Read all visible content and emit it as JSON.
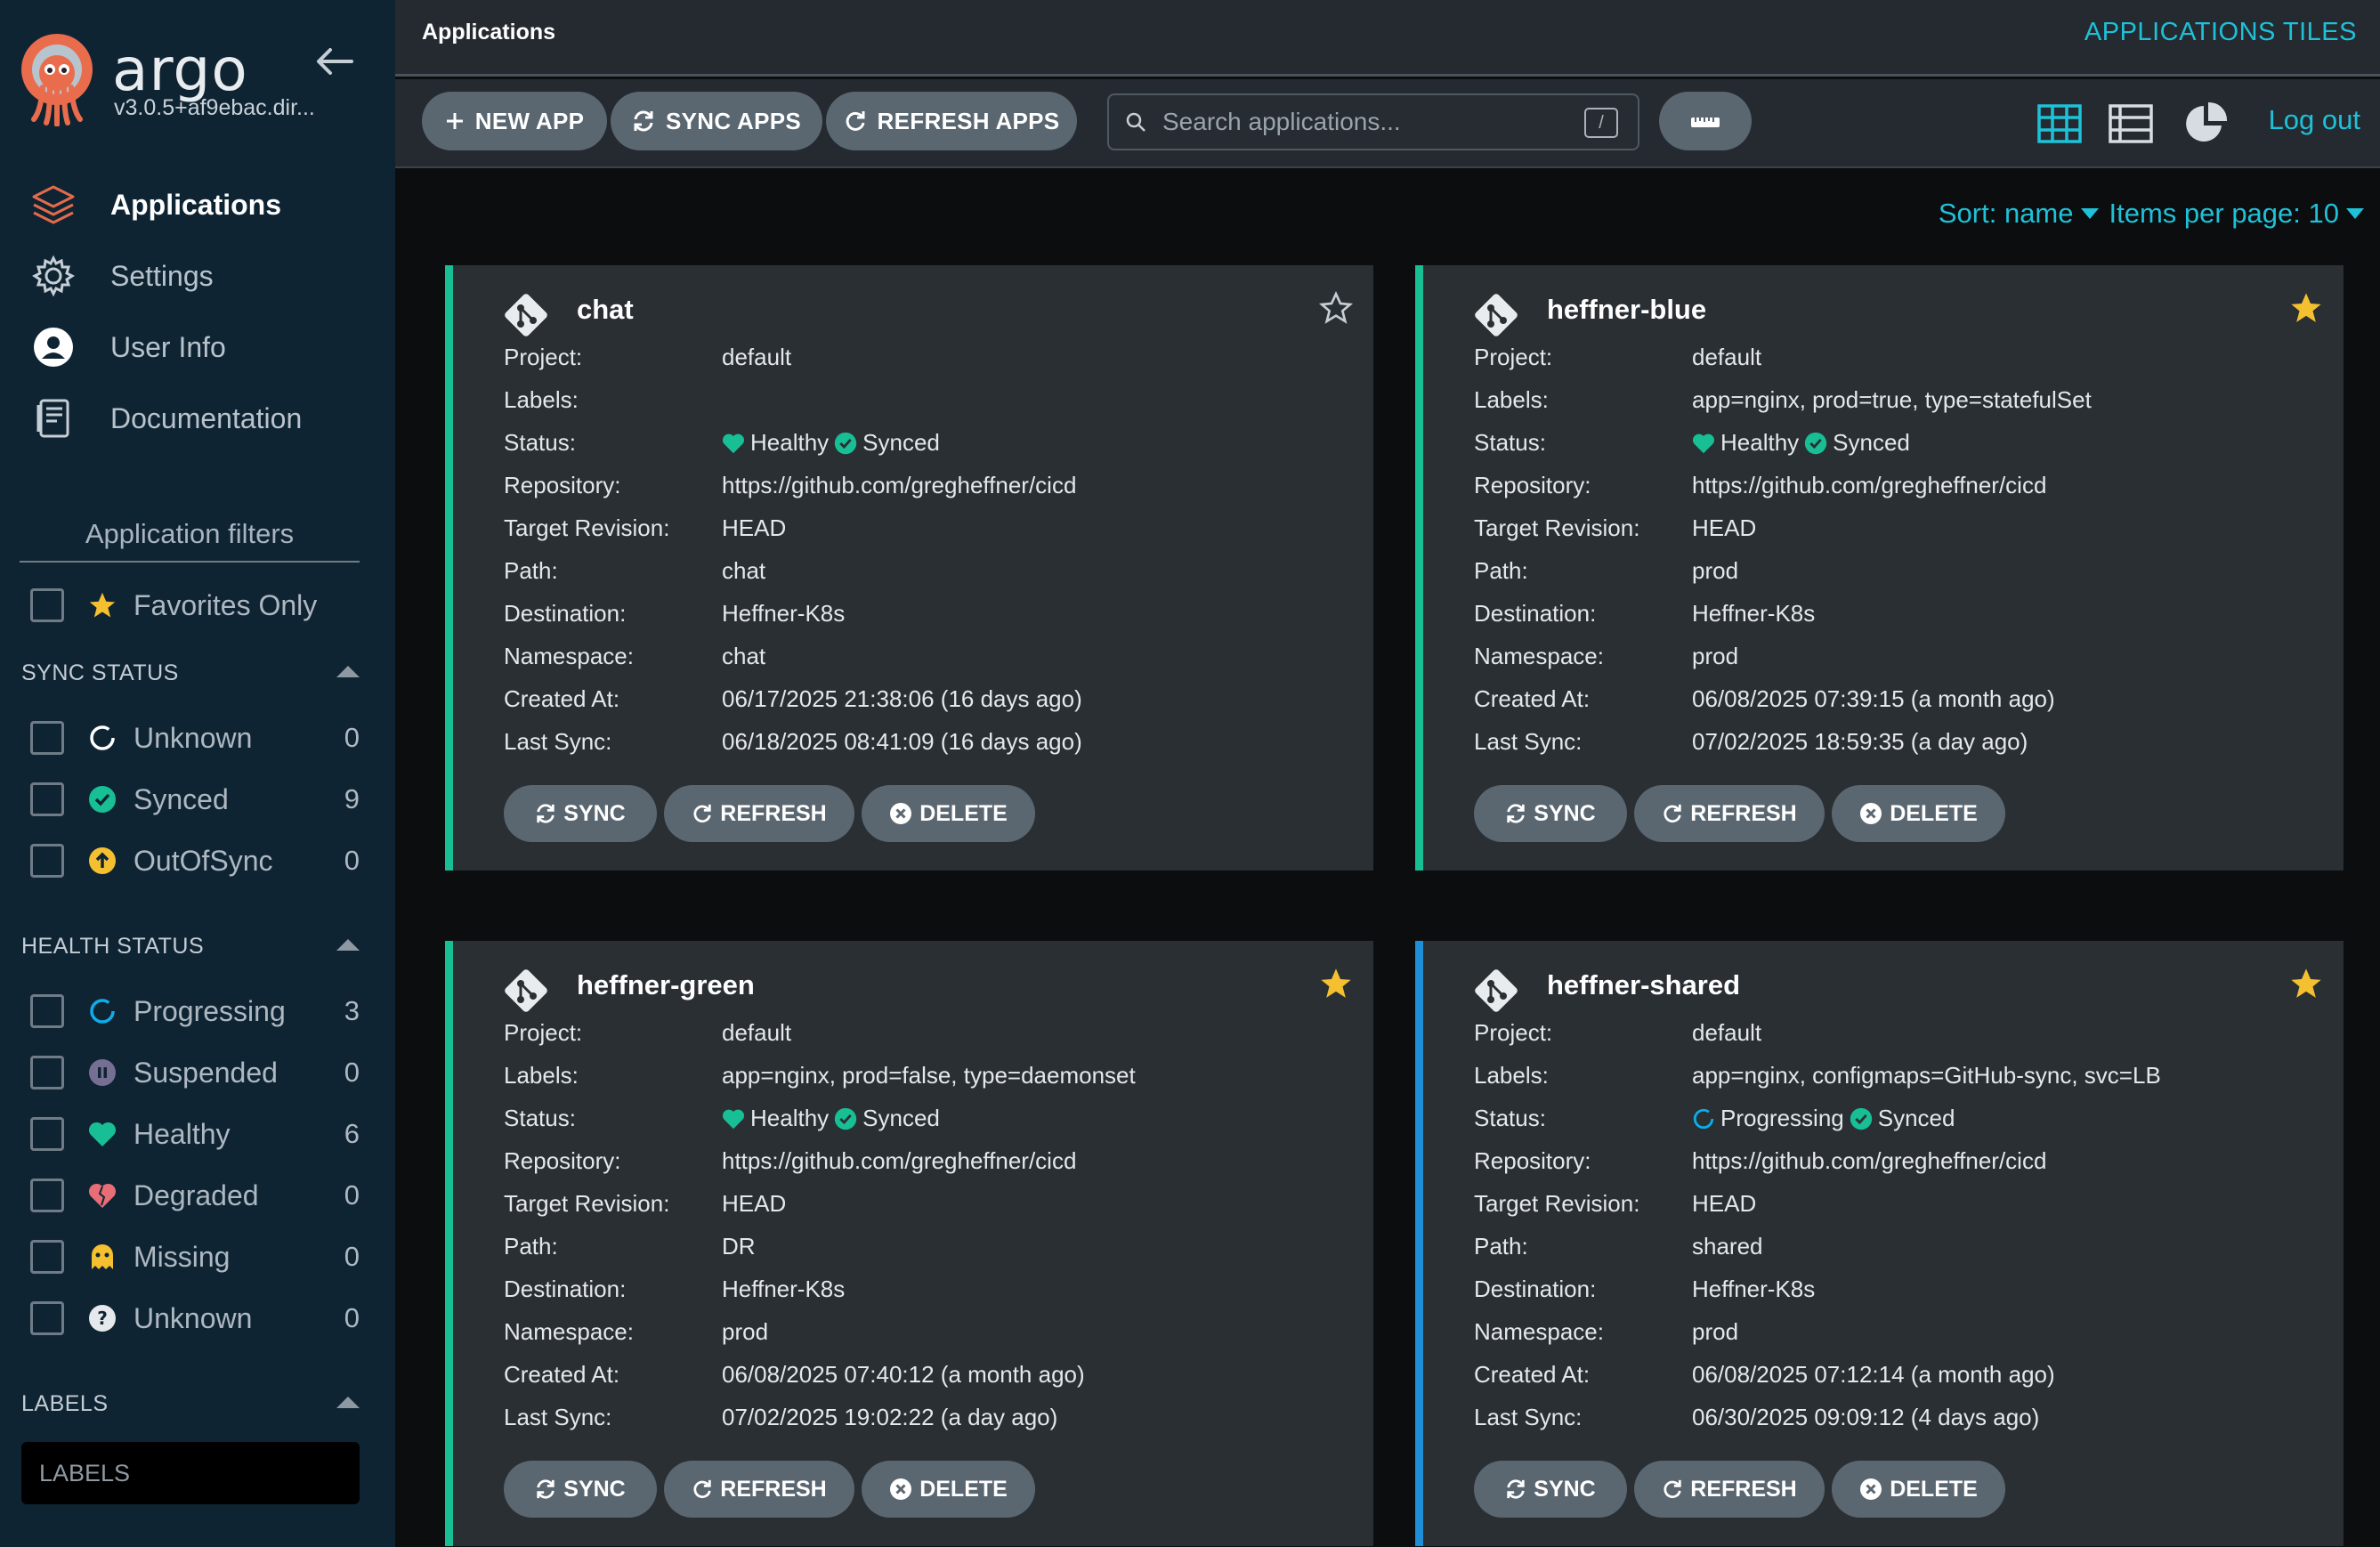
{
  "brand": {
    "name": "argo",
    "version": "v3.0.5+af9ebac.dir..."
  },
  "nav": [
    {
      "label": "Applications",
      "icon": "layers-icon"
    },
    {
      "label": "Settings",
      "icon": "gear-icon"
    },
    {
      "label": "User Info",
      "icon": "user-icon"
    },
    {
      "label": "Documentation",
      "icon": "docs-icon"
    }
  ],
  "filters": {
    "title": "Application filters",
    "favorites_label": "Favorites Only",
    "sync_status": {
      "title": "SYNC STATUS",
      "items": [
        {
          "label": "Unknown",
          "count": "0"
        },
        {
          "label": "Synced",
          "count": "9"
        },
        {
          "label": "OutOfSync",
          "count": "0"
        }
      ]
    },
    "health_status": {
      "title": "HEALTH STATUS",
      "items": [
        {
          "label": "Progressing",
          "count": "3"
        },
        {
          "label": "Suspended",
          "count": "0"
        },
        {
          "label": "Healthy",
          "count": "6"
        },
        {
          "label": "Degraded",
          "count": "0"
        },
        {
          "label": "Missing",
          "count": "0"
        },
        {
          "label": "Unknown",
          "count": "0"
        }
      ]
    },
    "labels": {
      "title": "LABELS",
      "placeholder": "LABELS"
    }
  },
  "header": {
    "title": "Applications",
    "view_title": "APPLICATIONS TILES"
  },
  "toolbar": {
    "new_app": "NEW APP",
    "sync_apps": "SYNC APPS",
    "refresh_apps": "REFRESH APPS",
    "search_placeholder": "Search applications...",
    "search_shortcut": "/",
    "logout": "Log out"
  },
  "sort": {
    "sort_label": "Sort: name",
    "per_page_label": "Items per page: 10"
  },
  "field_labels": {
    "project": "Project:",
    "labels": "Labels:",
    "status": "Status:",
    "repository": "Repository:",
    "target_revision": "Target Revision:",
    "path": "Path:",
    "destination": "Destination:",
    "namespace": "Namespace:",
    "created_at": "Created At:",
    "last_sync": "Last Sync:"
  },
  "card_actions": {
    "sync": "SYNC",
    "refresh": "REFRESH",
    "delete": "DELETE"
  },
  "colors": {
    "healthy": "#18be94",
    "progressing": "#0dadea",
    "favorite": "#f4c030",
    "accent": "#1fc1d9"
  },
  "apps": [
    {
      "name": "chat",
      "favorite": false,
      "project": "default",
      "labels": "",
      "health": "Healthy",
      "sync": "Synced",
      "repository": "https://github.com/gregheffner/cicd",
      "target_revision": "HEAD",
      "path": "chat",
      "destination": "Heffner-K8s",
      "namespace": "chat",
      "created_at": "06/17/2025 21:38:06  (16 days ago)",
      "last_sync": "06/18/2025 08:41:09  (16 days ago)"
    },
    {
      "name": "heffner-blue",
      "favorite": true,
      "project": "default",
      "labels": "app=nginx, prod=true, type=statefulSet",
      "health": "Healthy",
      "sync": "Synced",
      "repository": "https://github.com/gregheffner/cicd",
      "target_revision": "HEAD",
      "path": "prod",
      "destination": "Heffner-K8s",
      "namespace": "prod",
      "created_at": "06/08/2025 07:39:15  (a month ago)",
      "last_sync": "07/02/2025 18:59:35  (a day ago)"
    },
    {
      "name": "heffner-green",
      "favorite": true,
      "project": "default",
      "labels": "app=nginx, prod=false, type=daemonset",
      "health": "Healthy",
      "sync": "Synced",
      "repository": "https://github.com/gregheffner/cicd",
      "target_revision": "HEAD",
      "path": "DR",
      "destination": "Heffner-K8s",
      "namespace": "prod",
      "created_at": "06/08/2025 07:40:12  (a month ago)",
      "last_sync": "07/02/2025 19:02:22  (a day ago)"
    },
    {
      "name": "heffner-shared",
      "favorite": true,
      "project": "default",
      "labels": "app=nginx, configmaps=GitHub-sync, svc=LB",
      "health": "Progressing",
      "sync": "Synced",
      "repository": "https://github.com/gregheffner/cicd",
      "target_revision": "HEAD",
      "path": "shared",
      "destination": "Heffner-K8s",
      "namespace": "prod",
      "created_at": "06/08/2025 07:12:14  (a month ago)",
      "last_sync": "06/30/2025 09:09:12  (4 days ago)"
    }
  ]
}
